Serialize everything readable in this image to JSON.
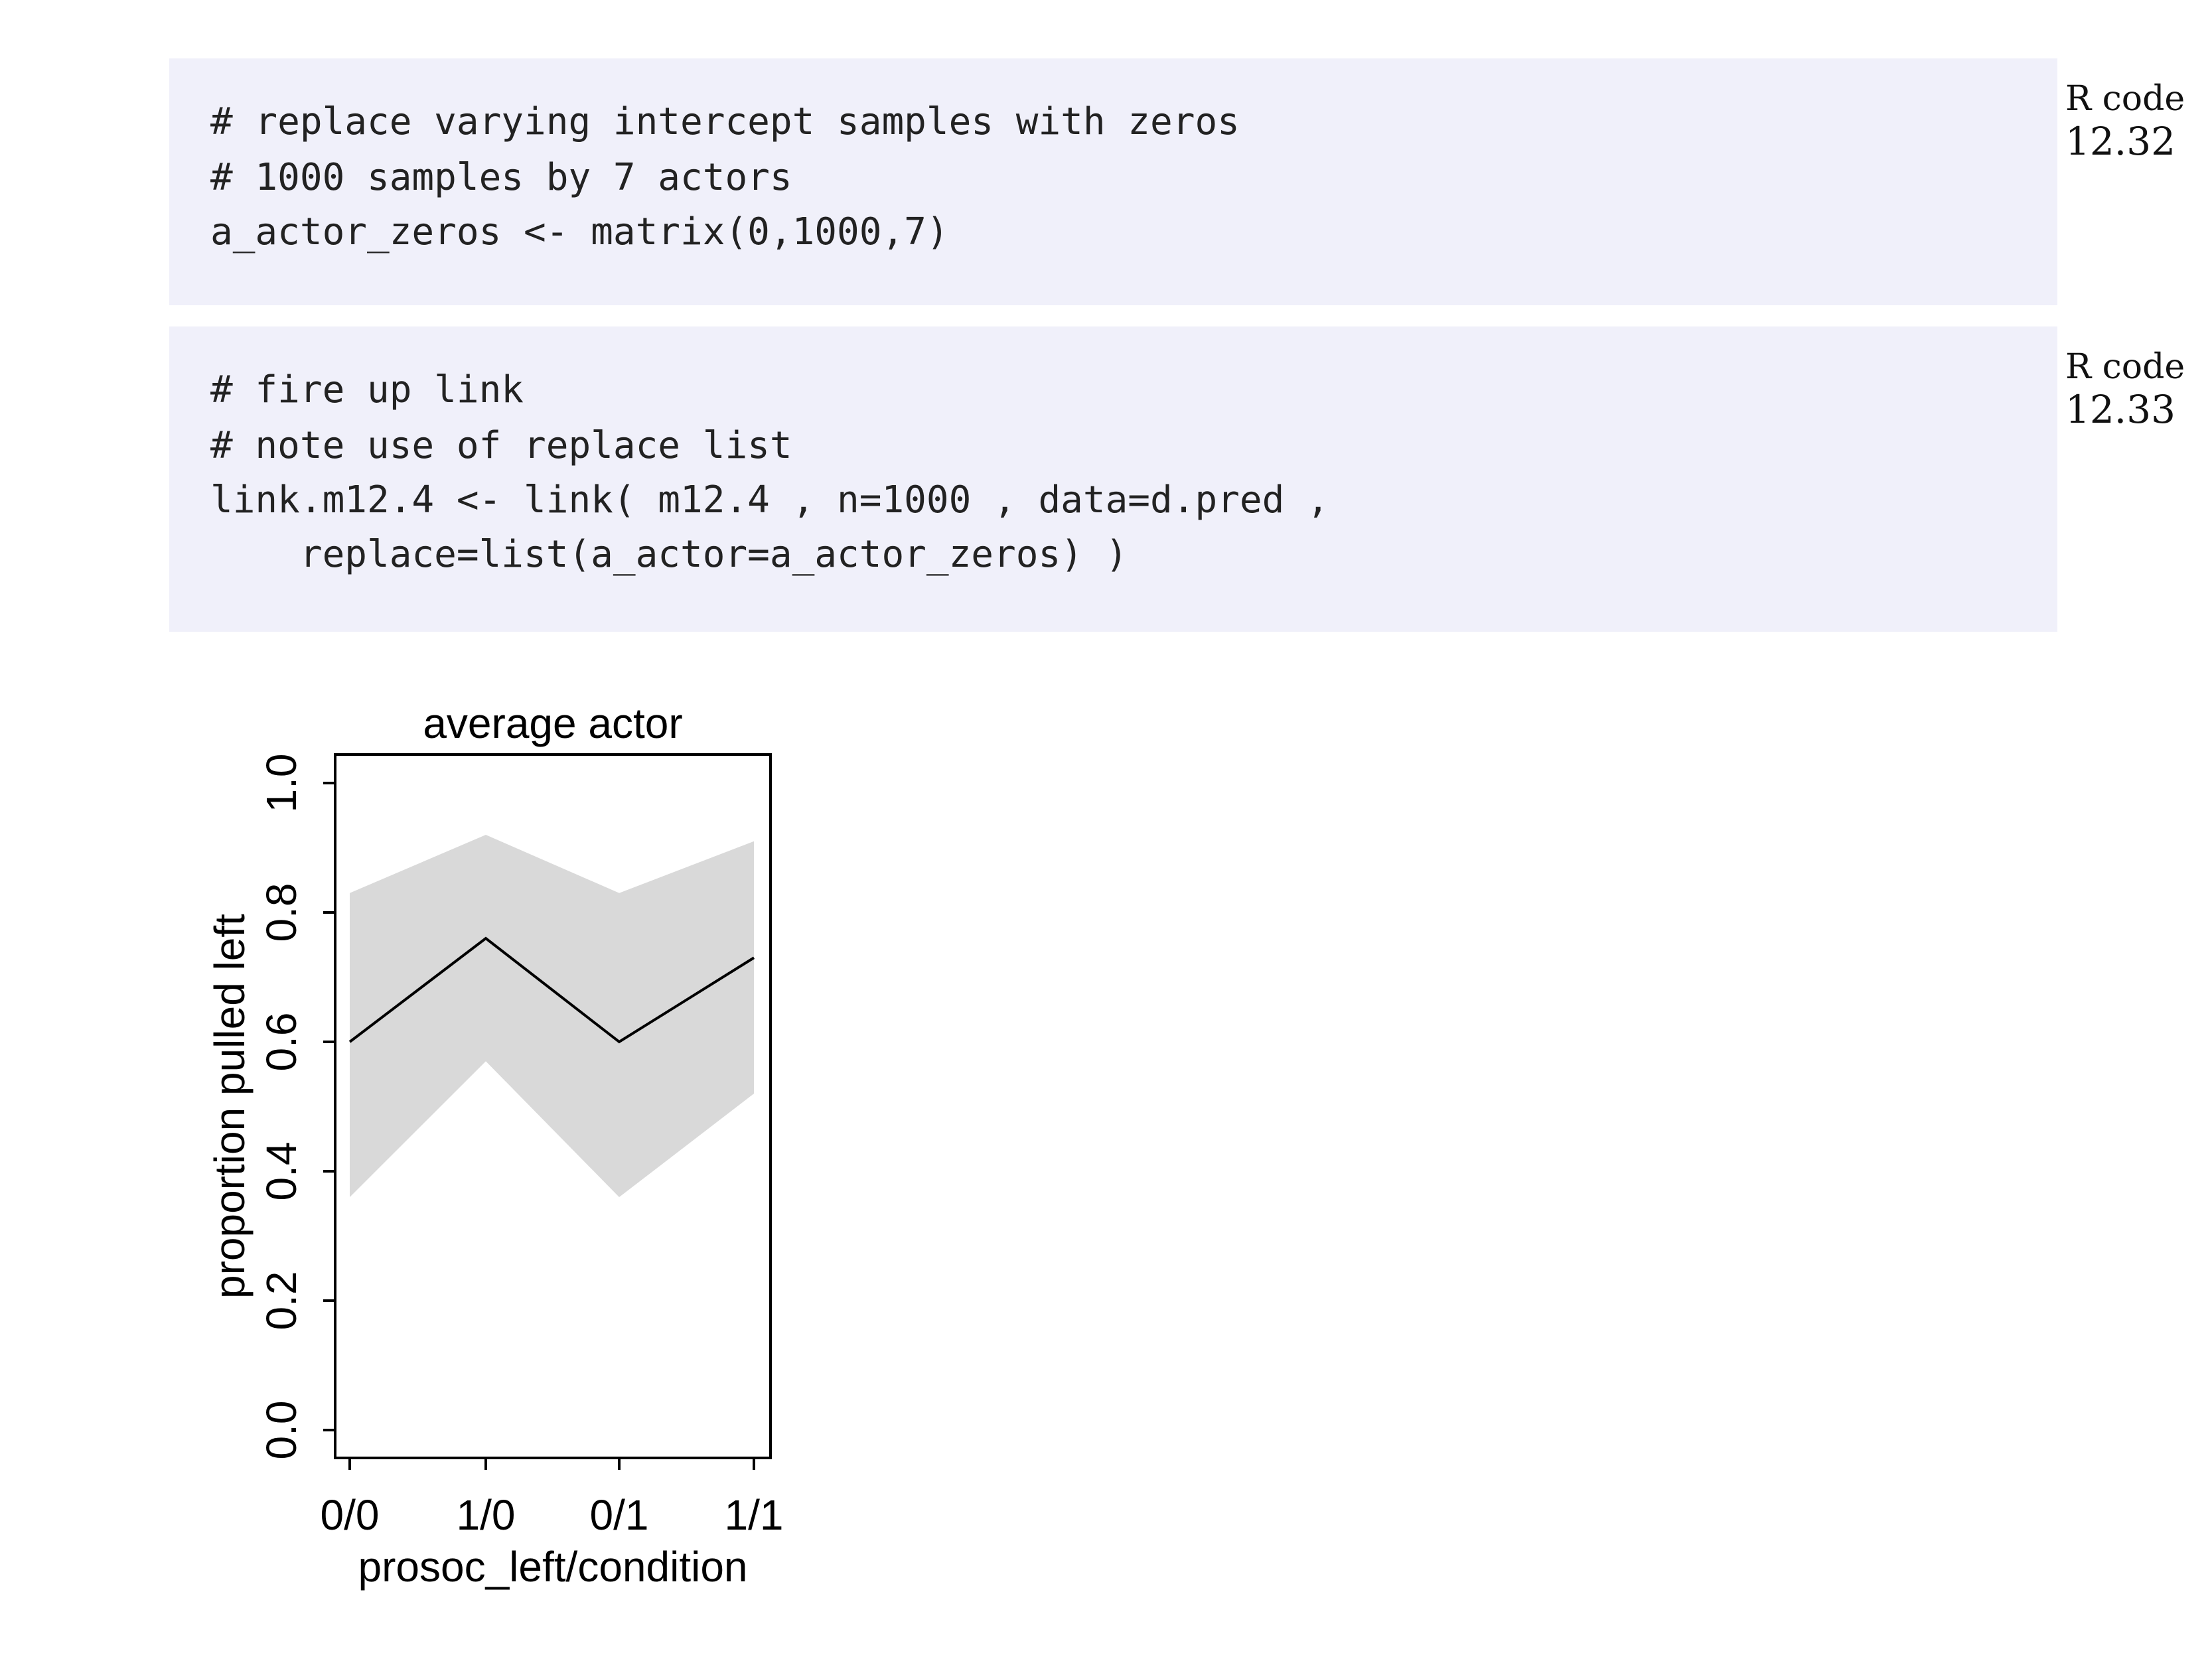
{
  "code_blocks": [
    {
      "label": "R code",
      "number": "12.32",
      "lines": [
        "# replace varying intercept samples with zeros",
        "# 1000 samples by 7 actors",
        "a_actor_zeros <- matrix(0,1000,7)"
      ]
    },
    {
      "label": "R code",
      "number": "12.33",
      "lines": [
        "# fire up link",
        "# note use of replace list",
        "link.m12.4 <- link( m12.4 , n=1000 , data=d.pred ,",
        "    replace=list(a_actor=a_actor_zeros) )"
      ]
    }
  ],
  "chart_data": {
    "type": "line",
    "title": "average actor",
    "xlabel": "prosoc_left/condition",
    "ylabel": "proportion pulled left",
    "categories": [
      "0/0",
      "1/0",
      "0/1",
      "1/1"
    ],
    "series": [
      {
        "values": [
          0.6,
          0.76,
          0.6,
          0.73
        ]
      }
    ],
    "interval": {
      "lower": [
        0.36,
        0.57,
        0.36,
        0.52
      ],
      "upper": [
        0.83,
        0.92,
        0.83,
        0.91
      ]
    },
    "ylim": [
      0,
      1
    ],
    "yticks": [
      "0.0",
      "0.2",
      "0.4",
      "0.6",
      "0.8",
      "1.0"
    ],
    "colors": {
      "line": "#000000",
      "band": "#d9d9d9"
    },
    "grid": false
  }
}
